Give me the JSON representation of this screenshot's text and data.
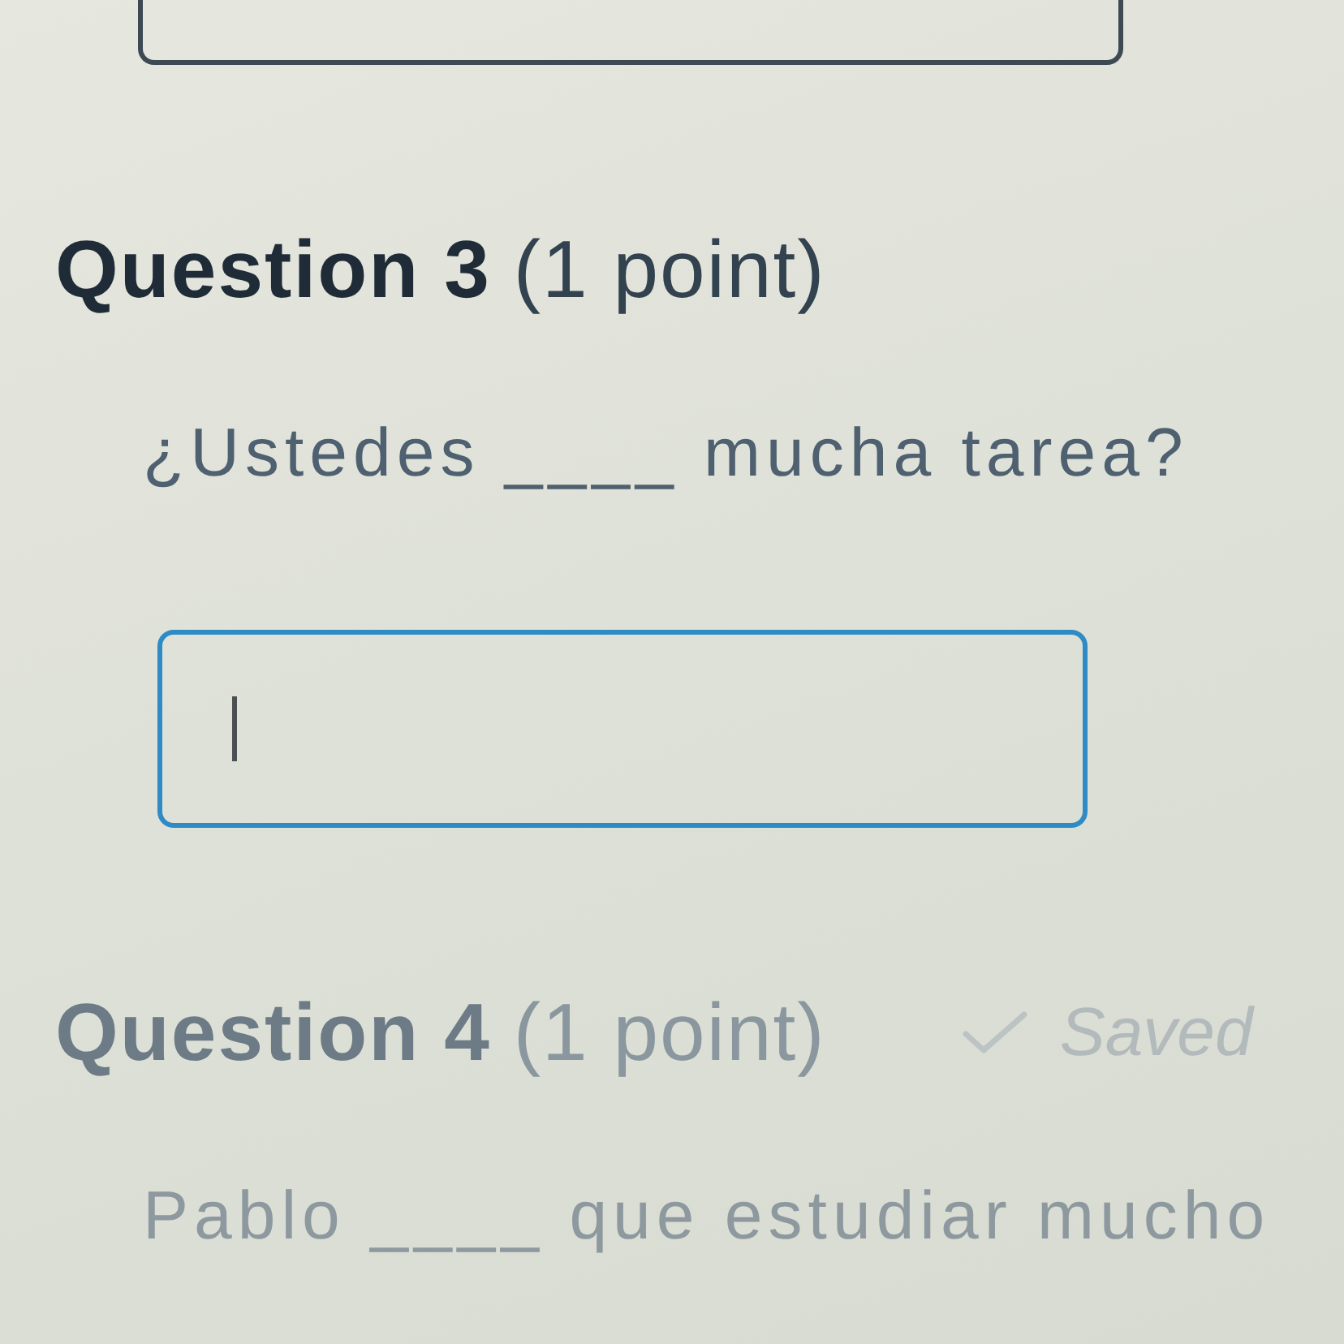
{
  "previous_question": {
    "answer_box": {
      "focused": false
    }
  },
  "questions": [
    {
      "title": "Question 3",
      "points": "(1 point)",
      "prompt": "¿Ustedes ____ mucha tarea?",
      "answer_box": {
        "focused": true
      },
      "dimmed": false
    },
    {
      "title": "Question 4",
      "points": "(1 point)",
      "status": "Saved",
      "prompt": "Pablo ____ que estudiar mucho",
      "dimmed": true
    }
  ]
}
